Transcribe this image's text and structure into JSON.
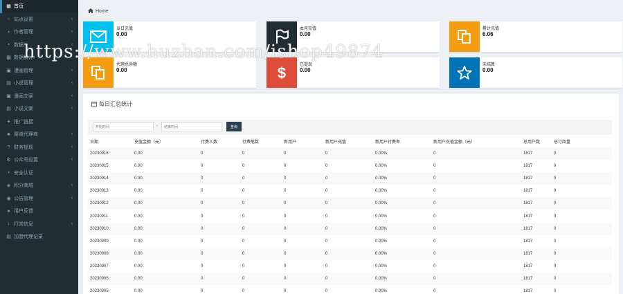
{
  "sidebar": {
    "items": [
      {
        "icon": "dashboard-icon",
        "glyph": "▦",
        "label": "首页",
        "active": true,
        "chevron": false
      },
      {
        "icon": "circle-icon",
        "glyph": "○",
        "label": "站点设置",
        "chevron": true
      },
      {
        "icon": "user-icon",
        "glyph": "▪",
        "label": "作者管理",
        "chevron": true
      },
      {
        "icon": "square-icon",
        "glyph": "▪",
        "label": "数据",
        "chevron": true
      },
      {
        "icon": "chart-icon",
        "glyph": "▦",
        "label": "数据统计",
        "chevron": false
      },
      {
        "icon": "image-icon",
        "glyph": "▣",
        "label": "漫画管理",
        "chevron": true
      },
      {
        "icon": "book-icon",
        "glyph": "▤",
        "label": "小说管理",
        "chevron": true
      },
      {
        "icon": "image-icon",
        "glyph": "▣",
        "label": "漫画文案",
        "chevron": true
      },
      {
        "icon": "book-icon",
        "glyph": "▤",
        "label": "小说文案",
        "chevron": true
      },
      {
        "icon": "gift-icon",
        "glyph": "✦",
        "label": "推广链接",
        "chevron": false
      },
      {
        "icon": "team-icon",
        "glyph": "♣",
        "label": "渠道代理商",
        "chevron": true
      },
      {
        "icon": "pay-icon",
        "glyph": "¤",
        "label": "财务提现",
        "chevron": true
      },
      {
        "icon": "gear-icon",
        "glyph": "⚙",
        "label": "公众号设置",
        "chevron": true
      },
      {
        "icon": "lock-icon",
        "glyph": "▪",
        "label": "安全认证",
        "chevron": false
      },
      {
        "icon": "shield-icon",
        "glyph": "◈",
        "label": "积分商城",
        "chevron": true
      },
      {
        "icon": "bell-icon",
        "glyph": "◉",
        "label": "公告管理",
        "chevron": true
      },
      {
        "icon": "comment-icon",
        "glyph": "●",
        "label": "用户反馈",
        "chevron": false
      },
      {
        "icon": "download-icon",
        "glyph": "↓",
        "label": "打赏信息",
        "chevron": true
      },
      {
        "icon": "list-icon",
        "glyph": "▤",
        "label": "加盟代理记录",
        "chevron": false
      }
    ]
  },
  "breadcrumb": {
    "icon": "home-icon",
    "label": "Home"
  },
  "cards": [
    {
      "name": "today-recharge",
      "label": "当日充值",
      "value": "0.00",
      "color": "#00c0ef",
      "icon": "envelope-icon"
    },
    {
      "name": "month-recharge",
      "label": "本月充值",
      "value": "0.00",
      "color": "#222d32",
      "icon": "flag-icon"
    },
    {
      "name": "total-recharge",
      "label": "累计充值",
      "value": "6.06",
      "color": "#f39c12",
      "icon": "copy-icon"
    },
    {
      "name": "agent-balance",
      "label": "代理总余额",
      "value": "0.00",
      "color": "#f39c12",
      "icon": "copy-icon"
    },
    {
      "name": "withdrawn",
      "label": "已提现",
      "value": "0.00",
      "color": "#dd4b39",
      "icon": "dollar-icon"
    },
    {
      "name": "unsettled",
      "label": "未结算",
      "value": "0.00",
      "color": "#0073b7",
      "icon": "star-icon"
    }
  ],
  "panel": {
    "title": "每日汇总统计",
    "start_placeholder": "开始时间",
    "end_placeholder": "结束时间",
    "separator": "-",
    "query_label": "查询"
  },
  "table": {
    "columns": [
      "日期",
      "充值金额（元）",
      "付费人数",
      "付费笔数",
      "新用户",
      "新用户充值",
      "新用户付费率",
      "新用户充值金额（元）",
      "总用户数",
      "总订阅量"
    ],
    "rows": [
      [
        "20230916",
        "0.00",
        "0",
        "0",
        "0",
        "0",
        "0.00%",
        "0",
        "1817",
        "0"
      ],
      [
        "20230915",
        "0.00",
        "0",
        "0",
        "0",
        "0",
        "0.00%",
        "0",
        "1817",
        "0"
      ],
      [
        "20230914",
        "0.00",
        "0",
        "0",
        "0",
        "0",
        "0.00%",
        "0",
        "1817",
        "0"
      ],
      [
        "20230913",
        "0.00",
        "0",
        "0",
        "0",
        "0",
        "0.00%",
        "0",
        "1817",
        "0"
      ],
      [
        "20230912",
        "0.00",
        "0",
        "0",
        "0",
        "0",
        "0.00%",
        "0",
        "1817",
        "0"
      ],
      [
        "20230911",
        "0.00",
        "0",
        "0",
        "0",
        "0",
        "0.00%",
        "0",
        "1817",
        "0"
      ],
      [
        "20230910",
        "0.00",
        "0",
        "0",
        "0",
        "0",
        "0.00%",
        "0",
        "1817",
        "0"
      ],
      [
        "20230909",
        "0.00",
        "0",
        "0",
        "0",
        "0",
        "0.00%",
        "0",
        "1817",
        "0"
      ],
      [
        "20230908",
        "0.00",
        "0",
        "0",
        "0",
        "0",
        "0.00%",
        "0",
        "1817",
        "0"
      ],
      [
        "20230907",
        "0.00",
        "0",
        "0",
        "0",
        "0",
        "0.00%",
        "0",
        "1817",
        "0"
      ],
      [
        "20230906",
        "0.00",
        "0",
        "0",
        "0",
        "0",
        "0.00%",
        "0",
        "1817",
        "0"
      ],
      [
        "20230905",
        "0.00",
        "0",
        "0",
        "0",
        "0",
        "0.00%",
        "0",
        "1817",
        "0"
      ]
    ]
  },
  "watermark": "https://www.huzhan.com/ishop49874"
}
